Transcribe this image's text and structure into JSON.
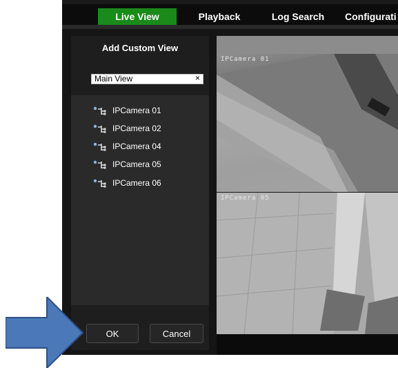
{
  "nav": {
    "tabs": [
      {
        "label": "Live View",
        "active": true
      },
      {
        "label": "Playback",
        "active": false
      },
      {
        "label": "Log Search",
        "active": false
      },
      {
        "label": "Configurati",
        "active": false
      }
    ]
  },
  "panel": {
    "title": "Add Custom View",
    "view_name_value": "Main View",
    "clear_glyph": "×",
    "cameras": [
      "IPCamera 01",
      "IPCamera 02",
      "IPCamera 04",
      "IPCamera 05",
      "IPCamera 06"
    ],
    "ok_label": "OK",
    "cancel_label": "Cancel"
  },
  "video": {
    "feeds": [
      {
        "label": "IPCamera 01"
      },
      {
        "label": "IPCamera 05"
      }
    ]
  },
  "colors": {
    "active_tab": "#1a8a1a",
    "arrow": "#4a78b8",
    "arrow_stroke": "#2f4f86"
  },
  "icons": {
    "camera_item": "camera-tree-icon",
    "pointer": "blue-arrow-annotation"
  }
}
